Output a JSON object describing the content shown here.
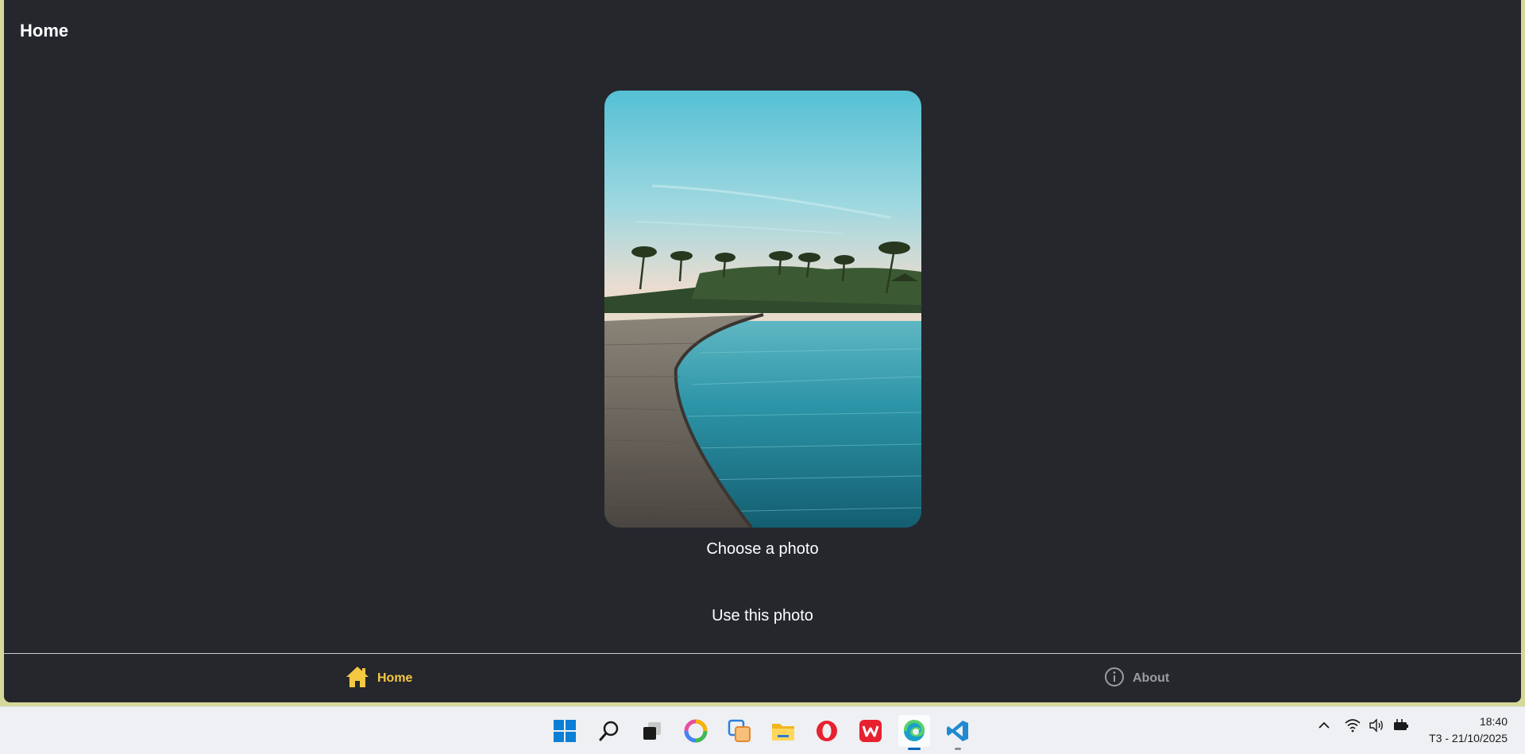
{
  "page": {
    "title": "Home"
  },
  "photo": {
    "alt": "beach boardwalk with palm trees"
  },
  "actions": {
    "choose_label": "Choose a photo",
    "use_label": "Use this photo"
  },
  "tabs": [
    {
      "label": "Home",
      "icon": "home-icon",
      "active": true,
      "color": "#f5c842"
    },
    {
      "label": "About",
      "icon": "info-icon",
      "active": false,
      "color": "#9a9da2"
    }
  ],
  "colors": {
    "app_background": "#25272d",
    "accent": "#f5c842",
    "window_border": "#d6d89a"
  },
  "taskbar": {
    "icons": [
      "windows-start-icon",
      "search-icon",
      "task-view-icon",
      "copilot-icon",
      "snipping-tool-icon",
      "file-explorer-icon",
      "opera-icon",
      "wps-office-icon",
      "edge-icon",
      "vscode-icon"
    ],
    "tray_icons": [
      "chevron-up-icon",
      "wifi-icon",
      "volume-icon",
      "battery-icon"
    ],
    "time": "18:40",
    "date": "T3 - 21/10/2025"
  }
}
